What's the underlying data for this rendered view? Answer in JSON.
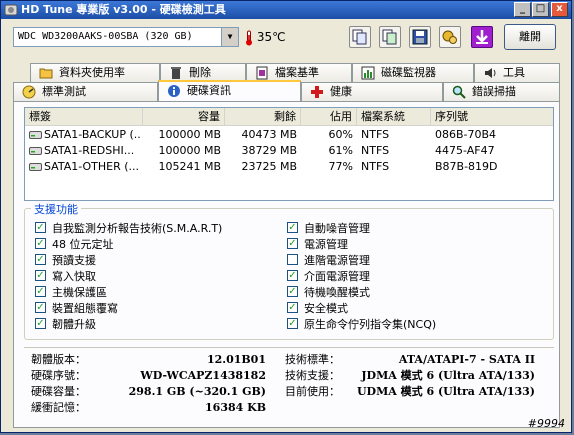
{
  "window": {
    "title": "HD Tune 專業版 v3.00 - 硬碟檢測工具",
    "controls": [
      "_",
      "□",
      "x"
    ]
  },
  "toolbar": {
    "drive": "WDC WD3200AAKS-00SBA (320 GB)",
    "temperature": "35℃",
    "buttons": [
      "copy-text-icon",
      "copy-screenshot-icon",
      "save-icon",
      "options-icon",
      "download-icon"
    ],
    "exit_label": "離開"
  },
  "tabs_top": [
    {
      "label": "資料夾使用率",
      "icon": "folder-icon"
    },
    {
      "label": "刪除",
      "icon": "trash-icon"
    },
    {
      "label": "檔案基準",
      "icon": "file-benchmark-icon"
    },
    {
      "label": "磁碟監視器",
      "icon": "monitor-icon"
    },
    {
      "label": "工具",
      "icon": "speaker-icon"
    }
  ],
  "tabs_bottom": [
    {
      "label": "標準測試",
      "icon": "benchmark-icon"
    },
    {
      "label": "硬碟資訊",
      "icon": "info-icon",
      "active": true
    },
    {
      "label": "健康",
      "icon": "health-icon"
    },
    {
      "label": "錯誤掃描",
      "icon": "search-icon"
    }
  ],
  "partitions": {
    "columns": [
      "標簽",
      "容量",
      "剩餘",
      "佔用",
      "檔案系統",
      "序列號"
    ],
    "rows": [
      [
        "SATA1-BACKUP (...",
        "100000 MB",
        "40473 MB",
        "60%",
        "NTFS",
        "086B-70B4"
      ],
      [
        "SATA1-REDSHI...",
        "100000 MB",
        "38729 MB",
        "61%",
        "NTFS",
        "4475-AF47"
      ],
      [
        "SATA1-OTHER (...",
        "105241 MB",
        "23725 MB",
        "77%",
        "NTFS",
        "B87B-819D"
      ]
    ]
  },
  "features": {
    "title": "支援功能",
    "left": [
      {
        "label": "自我監測分析報告技術(S.M.A.R.T)",
        "checked": true
      },
      {
        "label": "48 位元定址",
        "checked": true
      },
      {
        "label": "預讀支援",
        "checked": true
      },
      {
        "label": "寫入快取",
        "checked": true
      },
      {
        "label": "主機保護區",
        "checked": true
      },
      {
        "label": "裝置組態覆寫",
        "checked": true
      },
      {
        "label": "韌體升級",
        "checked": true
      }
    ],
    "right": [
      {
        "label": "自動噪音管理",
        "checked": true
      },
      {
        "label": "電源管理",
        "checked": true
      },
      {
        "label": "進階電源管理",
        "checked": false
      },
      {
        "label": "介面電源管理",
        "checked": true
      },
      {
        "label": "待機喚醒模式",
        "checked": true
      },
      {
        "label": "安全模式",
        "checked": true
      },
      {
        "label": "原生命令佇列指令集(NCQ)",
        "checked": true
      }
    ]
  },
  "info": {
    "left": [
      {
        "label": "韌體版本：",
        "value": "12.01B01"
      },
      {
        "label": "硬碟序號：",
        "value": "WD-WCAPZ1438182"
      },
      {
        "label": "硬碟容量：",
        "value": "298.1 GB (~320.1 GB)"
      },
      {
        "label": "緩衝記憶：",
        "value": "16384 KB"
      }
    ],
    "right": [
      {
        "label": "技術標準：",
        "value": "ATA/ATAPI-7 - SATA II"
      },
      {
        "label": "技術支援：",
        "value": "JDMA 模式 6 (Ultra ATA/133)"
      },
      {
        "label": "目前使用：",
        "value": "UDMA 模式 6 (Ultra ATA/133)"
      }
    ]
  },
  "watermark": "#9994"
}
